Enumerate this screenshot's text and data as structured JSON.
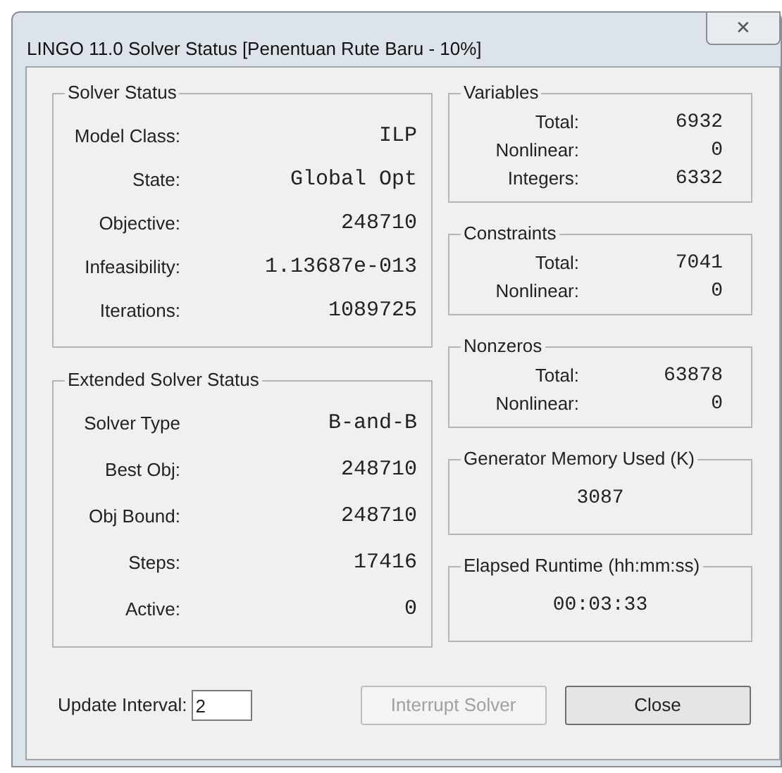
{
  "window": {
    "title": "LINGO 11.0 Solver Status [Penentuan Rute Baru - 10%]",
    "close": "✕"
  },
  "left_groups": [
    {
      "title": "Solver Status",
      "rows": [
        {
          "label": "Model Class:",
          "value": "ILP"
        },
        {
          "label": "State:",
          "value": "Global Opt"
        },
        {
          "label": "Objective:",
          "value": "248710"
        },
        {
          "label": "Infeasibility:",
          "value": "1.13687e-013"
        },
        {
          "label": "Iterations:",
          "value": "1089725"
        }
      ]
    },
    {
      "title": "Extended Solver Status",
      "rows": [
        {
          "label": "Solver Type",
          "value": "B-and-B"
        },
        {
          "label": "Best Obj:",
          "value": "248710"
        },
        {
          "label": "Obj Bound:",
          "value": "248710"
        },
        {
          "label": "Steps:",
          "value": "17416"
        },
        {
          "label": "Active:",
          "value": "0"
        }
      ]
    }
  ],
  "right_groups": [
    {
      "kind": "table",
      "title": "Variables",
      "rows": [
        {
          "label": "Total:",
          "value": "6932"
        },
        {
          "label": "Nonlinear:",
          "value": "0"
        },
        {
          "label": "Integers:",
          "value": "6332"
        }
      ]
    },
    {
      "kind": "table",
      "title": "Constraints",
      "rows": [
        {
          "label": "Total:",
          "value": "7041"
        },
        {
          "label": "Nonlinear:",
          "value": "0"
        }
      ]
    },
    {
      "kind": "table",
      "title": "Nonzeros",
      "rows": [
        {
          "label": "Total:",
          "value": "63878"
        },
        {
          "label": "Nonlinear:",
          "value": "0"
        }
      ]
    },
    {
      "kind": "single",
      "title": "Generator Memory Used (K)",
      "value": "3087"
    },
    {
      "kind": "single",
      "title": "Elapsed Runtime (hh:mm:ss)",
      "value": "00:03:33"
    }
  ],
  "update_interval": {
    "label": "Update Interval:",
    "value": "2"
  },
  "buttons": [
    {
      "label": "Interrupt Solver",
      "disabled": true
    },
    {
      "label": "Close",
      "disabled": false
    }
  ]
}
